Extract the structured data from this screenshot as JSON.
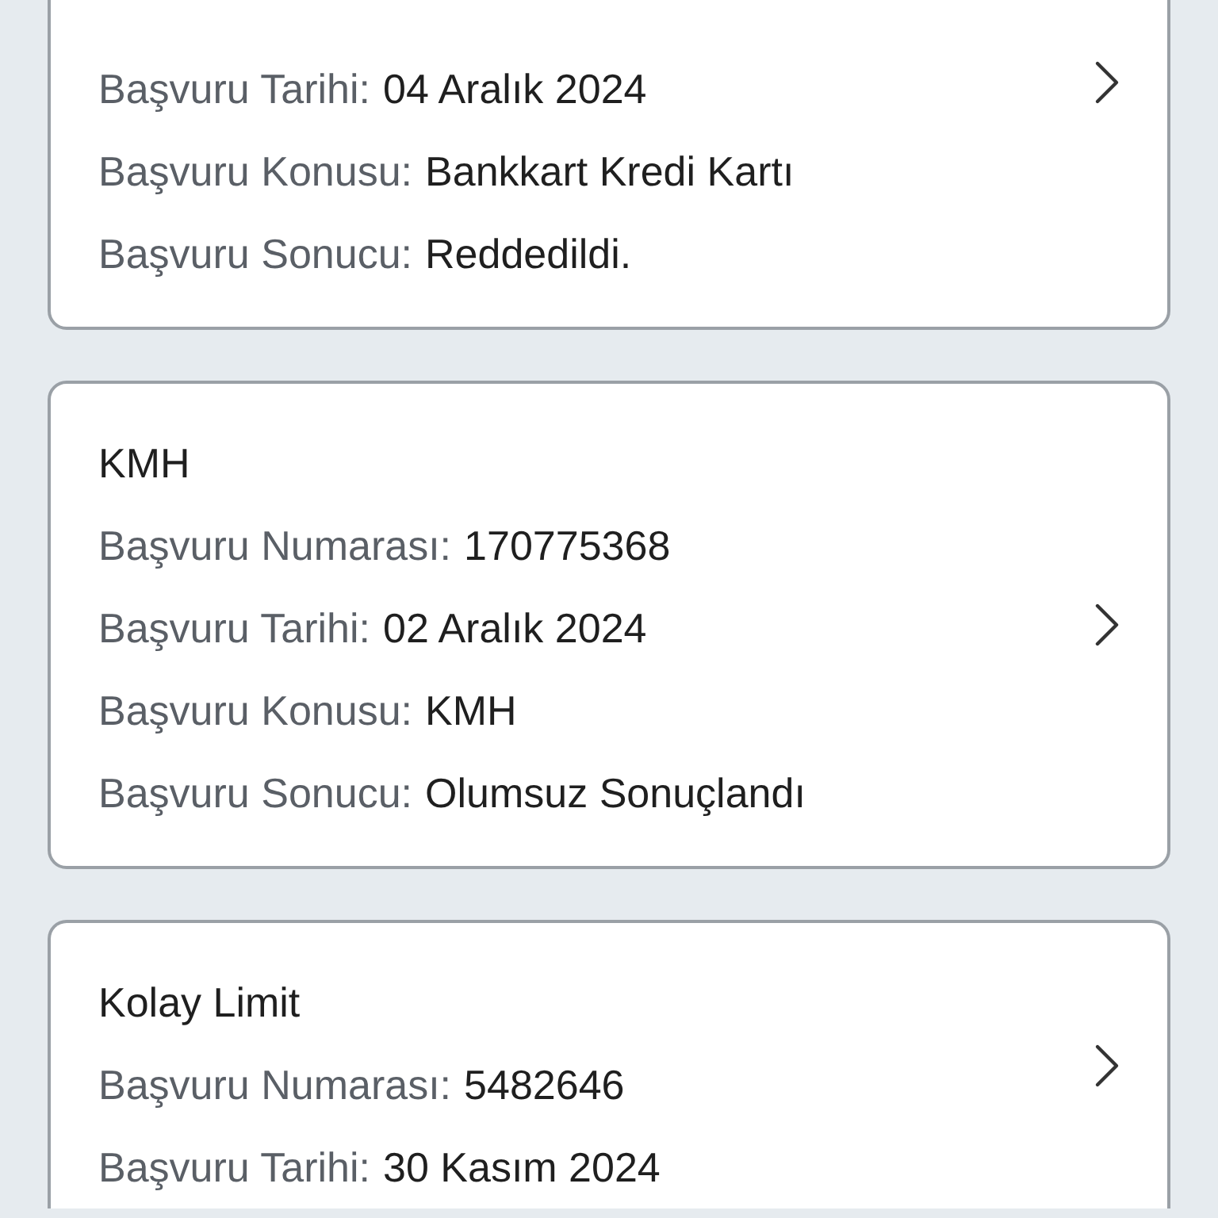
{
  "applications": [
    {
      "rows": [
        {
          "label": "Başvuru Tarihi:",
          "value": "04 Aralık 2024"
        },
        {
          "label": "Başvuru Konusu:",
          "value": "Bankkart Kredi Kartı"
        },
        {
          "label": "Başvuru Sonucu:",
          "value": "Reddedildi."
        }
      ]
    },
    {
      "title": "KMH",
      "rows": [
        {
          "label": "Başvuru Numarası:",
          "value": "170775368"
        },
        {
          "label": "Başvuru Tarihi:",
          "value": "02 Aralık 2024"
        },
        {
          "label": "Başvuru Konusu:",
          "value": "KMH"
        },
        {
          "label": "Başvuru Sonucu:",
          "value": "Olumsuz Sonuçlandı"
        }
      ]
    },
    {
      "title": "Kolay Limit",
      "rows": [
        {
          "label": "Başvuru Numarası:",
          "value": "5482646"
        },
        {
          "label": "Başvuru Tarihi:",
          "value": "30 Kasım 2024"
        }
      ]
    }
  ]
}
